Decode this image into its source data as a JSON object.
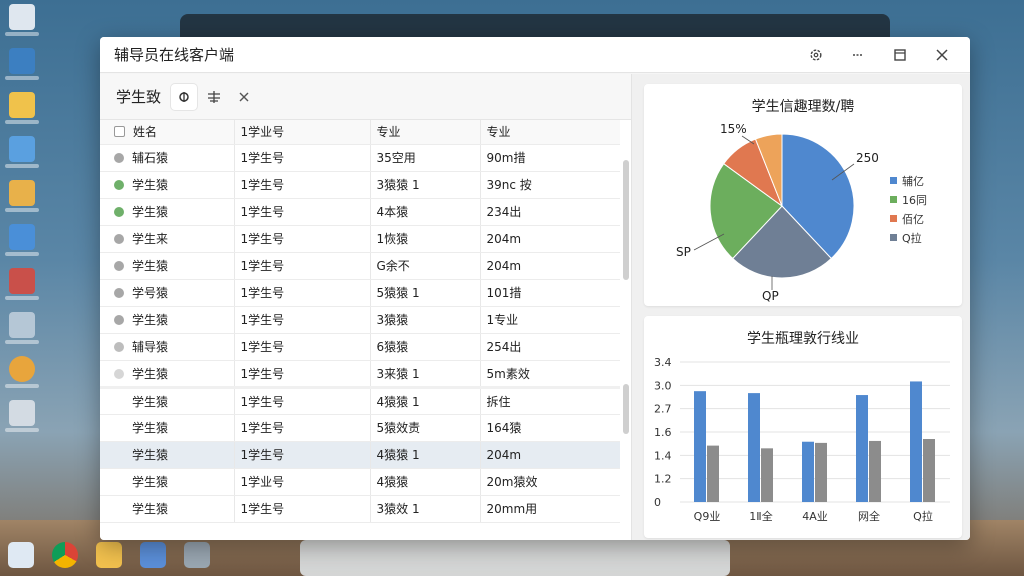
{
  "window": {
    "title": "辅导员在线客户端"
  },
  "left": {
    "title": "学生致",
    "table": {
      "headers": [
        "姓名",
        "1学业号",
        "专业",
        "专业"
      ],
      "rows": [
        {
          "name": "辅石猿",
          "id": "1学生号",
          "major": "35空用",
          "info": "90m措",
          "dot": "#a7a7a7"
        },
        {
          "name": "学生猿",
          "id": "1学生号",
          "major": "3猿猿 1",
          "info": "39nc 按",
          "dot": "#6fb06a"
        },
        {
          "name": "学生猿",
          "id": "1学生号",
          "major": "4本猿",
          "info": "234出",
          "dot": "#6fb06a"
        },
        {
          "name": "学生来",
          "id": "1学生号",
          "major": "1恢猿",
          "info": "204m",
          "dot": "#a7a7a7"
        },
        {
          "name": "学生猿",
          "id": "1学生号",
          "major": "G余不",
          "info": "204m",
          "dot": "#a7a7a7"
        },
        {
          "name": "学号猿",
          "id": "1学生号",
          "major": "5猿猿 1",
          "info": "101措",
          "dot": "#a7a7a7"
        },
        {
          "name": "学生猿",
          "id": "1学生号",
          "major": "3猿猿",
          "info": "1专业",
          "dot": "#a7a7a7"
        },
        {
          "name": "辅导猿",
          "id": "1学生号",
          "major": "6猿猿",
          "info": "254出",
          "dot": "#bdbdbd"
        },
        {
          "name": "学生猿",
          "id": "1学生号",
          "major": "3来猿 1",
          "info": "5m素效",
          "dot": "#d6d6d6"
        },
        {
          "name": "学生猿",
          "id": "1学生号",
          "major": "4猿猿 1",
          "info": "拆住",
          "dot": ""
        },
        {
          "name": "学生猿",
          "id": "1学生号",
          "major": "5猿效责",
          "info": "164猿",
          "dot": ""
        },
        {
          "name": "学生猿",
          "id": "1学生号",
          "major": "4猿猿 1",
          "info": "204m",
          "dot": ""
        },
        {
          "name": "学生猿",
          "id": "1学业号",
          "major": "4猿猿",
          "info": "20m猿效",
          "dot": ""
        },
        {
          "name": "学生猿",
          "id": "1学生号",
          "major": "3猿效 1",
          "info": "20mm用",
          "dot": ""
        }
      ]
    }
  },
  "colors": {
    "blue": "#4f88cf",
    "green": "#6cae5d",
    "orange": "#e07850",
    "light_orange": "#eda35a",
    "slate": "#6f7f95",
    "gray": "#8c8c8c"
  },
  "chart_data": [
    {
      "type": "pie",
      "title": "学生信趣理数/聘",
      "slices": [
        {
          "label": "辅亿",
          "value": 38,
          "color": "#4f88cf"
        },
        {
          "label": "QP",
          "value": 24,
          "color": "#6f7f95"
        },
        {
          "label": "16同",
          "value": 23,
          "color": "#6cae5d"
        },
        {
          "label": "佰亿",
          "value": 9,
          "color": "#e07850"
        },
        {
          "label": "",
          "value": 6,
          "color": "#eda35a"
        }
      ],
      "annotations": [
        "15%",
        "250",
        "SP",
        "QP"
      ],
      "legend": [
        "辅亿",
        "16同",
        "佰亿",
        "Q拉"
      ],
      "legend_colors": [
        "#4f88cf",
        "#6cae5d",
        "#e07850",
        "#6f7f95"
      ],
      "legend_position": "right"
    },
    {
      "type": "bar",
      "title": "学生瓶理敦行线业",
      "categories": [
        "Q9业",
        "1Ⅱ全",
        "4A业",
        "网全",
        "Q拉"
      ],
      "series": [
        {
          "values": [
            2.85,
            2.8,
            1.55,
            2.75,
            3.1
          ],
          "color": "#4f88cf"
        },
        {
          "values": [
            1.45,
            1.38,
            1.52,
            1.57,
            1.62
          ],
          "color": "#8c8c8c"
        }
      ],
      "yticks": [
        "3.4",
        "3.0",
        "2.7",
        "1.6",
        "1.4",
        "1.2",
        "0"
      ],
      "ylim": [
        0,
        3.6
      ],
      "grid": true
    }
  ]
}
